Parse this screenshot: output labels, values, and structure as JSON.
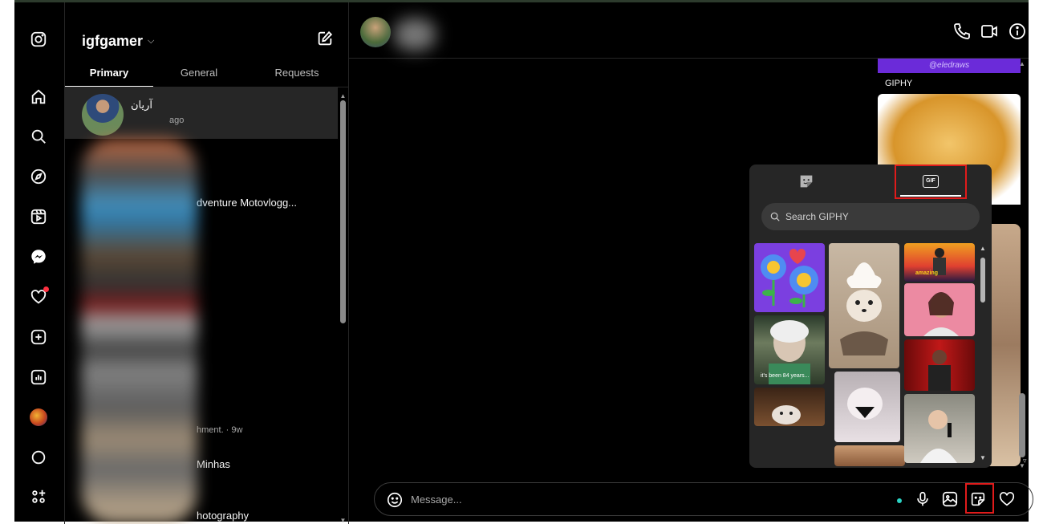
{
  "sidebar": {
    "icons": [
      "instagram-icon",
      "home-icon",
      "search-icon",
      "explore-icon",
      "reels-icon",
      "messenger-icon",
      "notifications-icon",
      "create-icon",
      "dashboard-icon",
      "profile-avatar",
      "threads-icon",
      "more-icon"
    ],
    "notification_dot_color": "#ff3040"
  },
  "inbox": {
    "account_name": "igfgamer",
    "tabs": [
      {
        "label": "Primary",
        "active": true
      },
      {
        "label": "General",
        "active": false
      },
      {
        "label": "Requests",
        "active": false
      }
    ],
    "conversations": [
      {
        "name": "آریان",
        "subtitle": "ago",
        "selected": true
      },
      {
        "name": "",
        "subtitle": ""
      },
      {
        "name": "dventure Motovlogg...",
        "subtitle": ""
      },
      {
        "name": "",
        "subtitle": ""
      },
      {
        "name": "",
        "subtitle": ""
      },
      {
        "name": "",
        "subtitle": ""
      },
      {
        "name": "",
        "subtitle": "hment. · 9w"
      },
      {
        "name": "Minhas",
        "subtitle": ""
      },
      {
        "name": "hotography",
        "subtitle": ""
      }
    ]
  },
  "chat": {
    "header_icons": [
      "phone-icon",
      "video-icon",
      "info-icon"
    ],
    "giphy_watermark": "@eledraws",
    "giphy_label": "GIPHY",
    "message_placeholder": "Message...",
    "toolbar_icons": [
      "microphone-icon",
      "image-icon",
      "sticker-icon",
      "heart-icon"
    ],
    "highlight_color": "#e01b1b"
  },
  "gif_picker": {
    "tabs": [
      {
        "name": "stickers-tab",
        "active": false
      },
      {
        "name": "gif-tab",
        "label": "GIF",
        "active": true
      }
    ],
    "search_placeholder": "Search GIPHY",
    "gifs": [
      {
        "id": "flowers",
        "caption": ""
      },
      {
        "id": "old-lady",
        "caption": "it's been 84 years..."
      },
      {
        "id": "dog-1",
        "caption": ""
      },
      {
        "id": "chihuahua-whipped-cream",
        "caption": ""
      },
      {
        "id": "cat-pose",
        "caption": ""
      },
      {
        "id": "dancer-sunset",
        "caption": "amazing"
      },
      {
        "id": "woman-pink",
        "caption": ""
      },
      {
        "id": "man-red-curtain",
        "caption": ""
      },
      {
        "id": "man-microphone",
        "caption": ""
      }
    ]
  }
}
